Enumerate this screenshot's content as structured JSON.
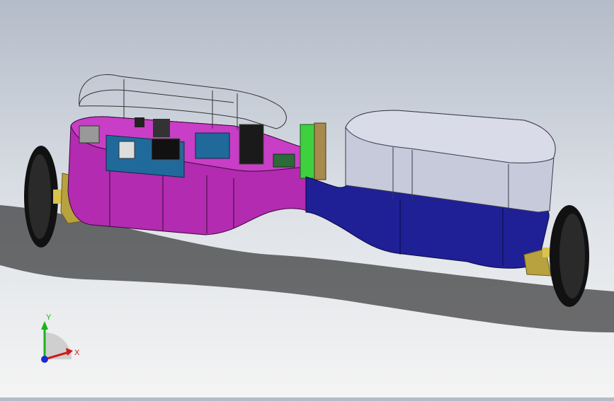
{
  "model": {
    "description_visible": false,
    "colors": {
      "background_top": "#b4bcc9",
      "background_bottom": "#f4f4f4",
      "left_body": "#b22bb0",
      "left_body_dark": "#8a1d88",
      "right_body_top": "#c7cadb",
      "right_body_bottom": "#1f2096",
      "divider_green": "#3fd03f",
      "wheel": "#141414",
      "bracket": "#c9b04a",
      "board": "#1f6a9a"
    }
  },
  "triad": {
    "x_label": "X",
    "y_label": "Y",
    "x_color": "#d11a1a",
    "y_color": "#1bb31b",
    "z_color": "#1a2ad1"
  }
}
